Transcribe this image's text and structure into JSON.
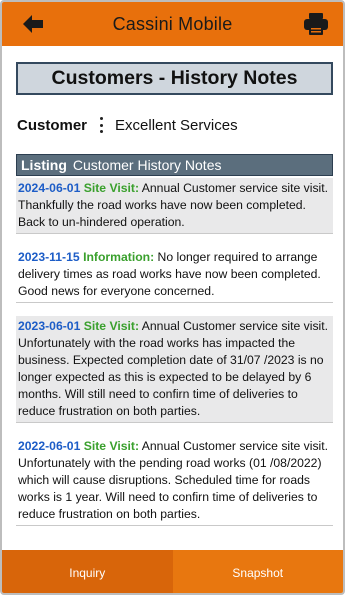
{
  "header": {
    "title": "Cassini Mobile",
    "back_icon": "arrow-left-icon",
    "print_icon": "printer-icon",
    "bar_color": "#e8700c"
  },
  "page": {
    "title": "Customers - History Notes"
  },
  "customer": {
    "label": "Customer",
    "menu_icon": "kebab-menu-icon",
    "value": "Excellent Services"
  },
  "listing": {
    "label": "Listing",
    "title": "Customer History Notes"
  },
  "notes": [
    {
      "date": "2024-06-01",
      "type": "Site Visit:",
      "text": " Annual Customer service site visit. Thankfully the road works have now been completed. Back to un-hindered operation."
    },
    {
      "date": "2023-11-15",
      "type": "Information:",
      "text": " No longer required to arrange delivery times as road works have now been completed. Good news for everyone concerned."
    },
    {
      "date": "2023-06-01",
      "type": "Site Visit:",
      "text": " Annual Customer service site visit. Unfortunately with the road works has impacted the business. Expected completion date of 31/07 /2023 is no longer expected as this is expected to be delayed by 6 months. Will still need to confirn time of deliveries to reduce frustration on both parties."
    },
    {
      "date": "2022-06-01",
      "type": "Site Visit:",
      "text": " Annual Customer service site visit. Unfortunately with the pending road works (01 /08/2022) which will cause disruptions. Scheduled time for roads works is 1 year. Will need to confirn time of deliveries to reduce frustration on both parties."
    }
  ],
  "tabs": {
    "inquiry": "Inquiry",
    "snapshot": "Snapshot"
  }
}
